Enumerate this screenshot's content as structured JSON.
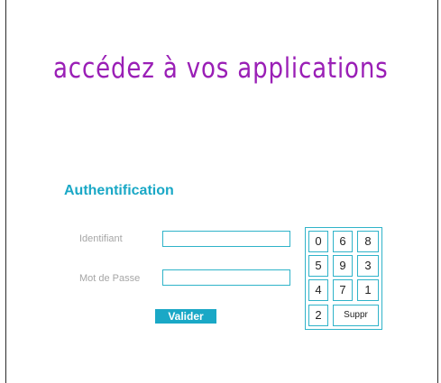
{
  "header": {
    "headline": "accédez à vos applications"
  },
  "auth": {
    "title": "Authentification",
    "identifiant_label": "Identifiant",
    "identifiant_value": "",
    "password_label": "Mot de Passe",
    "password_value": "",
    "submit_label": "Valider"
  },
  "keypad": {
    "keys": [
      "0",
      "6",
      "8",
      "5",
      "9",
      "3",
      "4",
      "7",
      "1",
      "2"
    ],
    "delete_label": "Suppr"
  },
  "colors": {
    "headline": "#9a1fb6",
    "accent": "#1aa8c6",
    "border": "#2fb3c9",
    "label": "#a6a6a6"
  }
}
